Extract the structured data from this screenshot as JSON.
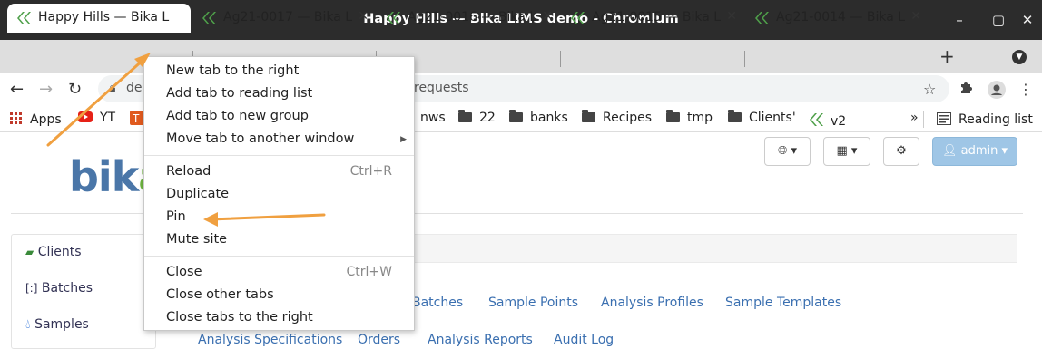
{
  "window": {
    "title": "Happy Hills — Bika LIMS demo - Chromium"
  },
  "tabs": [
    {
      "label": "Happy Hills — Bika L"
    },
    {
      "label": "Ag21-0017 — Bika L"
    },
    {
      "label": "Ag21-0016 — Bika L"
    },
    {
      "label": "Ag21-0015 — Bika L"
    },
    {
      "label": "Ag21-0014 — Bika L"
    }
  ],
  "toolbar": {
    "url_left": "de",
    "url_right": "requests"
  },
  "bookmarks": {
    "apps": "Apps",
    "yt": "YT",
    "items": [
      "nws",
      "22",
      "banks",
      "Recipes",
      "tmp",
      "Clients'"
    ],
    "v2": "v2",
    "more": "»",
    "reading_list": "Reading list"
  },
  "context_menu": {
    "new_tab_right": "New tab to the right",
    "add_reading_list": "Add tab to reading list",
    "add_new_group": "Add tab to new group",
    "move_window": "Move tab to another window",
    "reload": "Reload",
    "reload_shortcut": "Ctrl+R",
    "duplicate": "Duplicate",
    "pin": "Pin",
    "mute": "Mute site",
    "close": "Close",
    "close_shortcut": "Ctrl+W",
    "close_other": "Close other tabs",
    "close_right": "Close tabs to the right"
  },
  "header": {
    "logo_text": "bik",
    "logo_tail": "a",
    "admin_label": "admin"
  },
  "sidebar": {
    "items": [
      {
        "label": "Clients"
      },
      {
        "label": "Batches"
      },
      {
        "label": "Samples"
      }
    ]
  },
  "setup_links": {
    "row1": [
      "Batches",
      "Sample Points",
      "Analysis Profiles",
      "Sample Templates"
    ],
    "row2": [
      "Analysis Specifications",
      "Orders",
      "Analysis Reports",
      "Audit Log"
    ]
  },
  "colors": {
    "annotation_arrow": "#f0a040",
    "link": "#3a6fb0",
    "favicon_green": "#4fa04a"
  }
}
